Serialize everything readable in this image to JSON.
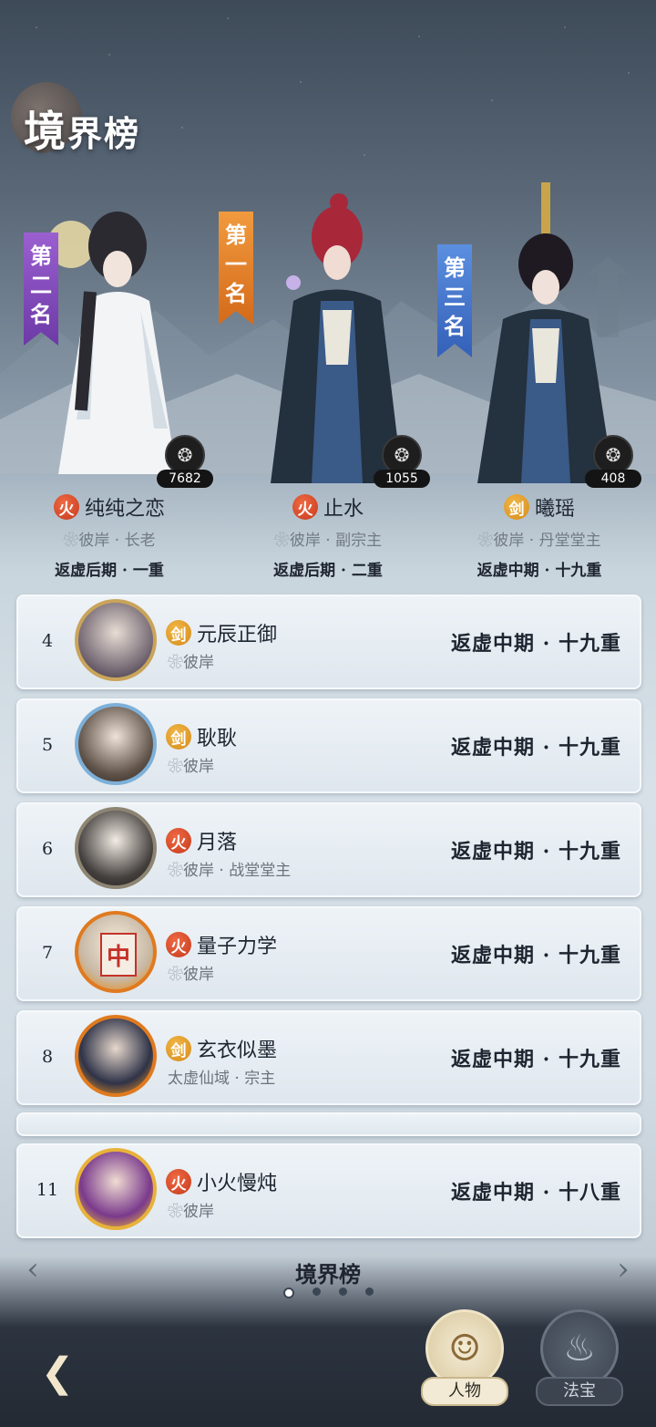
{
  "header": {
    "title_big": "境",
    "title_rest": "界榜"
  },
  "podium": [
    {
      "rank_label": "第二名",
      "name": "纯纯之恋",
      "element": "火",
      "element_type": "fire",
      "sect": "彼岸 · 长老",
      "realm": "返虚后期 · 一重",
      "score": "7682"
    },
    {
      "rank_label": "第一名",
      "name": "止水",
      "element": "火",
      "element_type": "fire",
      "sect": "彼岸 · 副宗主",
      "realm": "返虚后期 · 二重",
      "score": "1055"
    },
    {
      "rank_label": "第三名",
      "name": "曦瑶",
      "element": "剑",
      "element_type": "sword",
      "sect": "彼岸 · 丹堂堂主",
      "realm": "返虚中期 · 十九重",
      "score": "408"
    }
  ],
  "rank_banners": {
    "second": [
      "第",
      "二",
      "名"
    ],
    "first": [
      "第",
      "一",
      "名"
    ],
    "third": [
      "第",
      "三",
      "名"
    ]
  },
  "list": [
    {
      "rank": "4",
      "element": "剑",
      "element_type": "sword",
      "name": "元辰正御",
      "sect": "彼岸",
      "realm": "返虚中期 · 十九重"
    },
    {
      "rank": "5",
      "element": "剑",
      "element_type": "sword",
      "name": "耿耿",
      "sect": "彼岸",
      "realm": "返虚中期 · 十九重"
    },
    {
      "rank": "6",
      "element": "火",
      "element_type": "fire",
      "name": "月落",
      "sect": "彼岸 · 战堂堂主",
      "realm": "返虚中期 · 十九重"
    },
    {
      "rank": "7",
      "element": "火",
      "element_type": "fire",
      "name": "量子力学",
      "sect": "彼岸",
      "realm": "返虚中期 · 十九重",
      "avatar_mark": "中"
    },
    {
      "rank": "8",
      "element": "剑",
      "element_type": "sword",
      "name": "玄衣似墨",
      "sect": "太虚仙域 · 宗主",
      "realm": "返虚中期 · 十九重"
    },
    {
      "rank": "11",
      "element": "火",
      "element_type": "fire",
      "name": "小火慢炖",
      "sect": "彼岸",
      "realm": "返虚中期 · 十八重"
    }
  ],
  "pager": {
    "label": "境界榜",
    "total_pages": 4,
    "current_page": 1
  },
  "tabs": {
    "people": "人物",
    "treasure": "法宝"
  },
  "colors": {
    "fire": "#c6391c",
    "sword": "#d58c1a",
    "gold_border": "#c9a45a"
  }
}
